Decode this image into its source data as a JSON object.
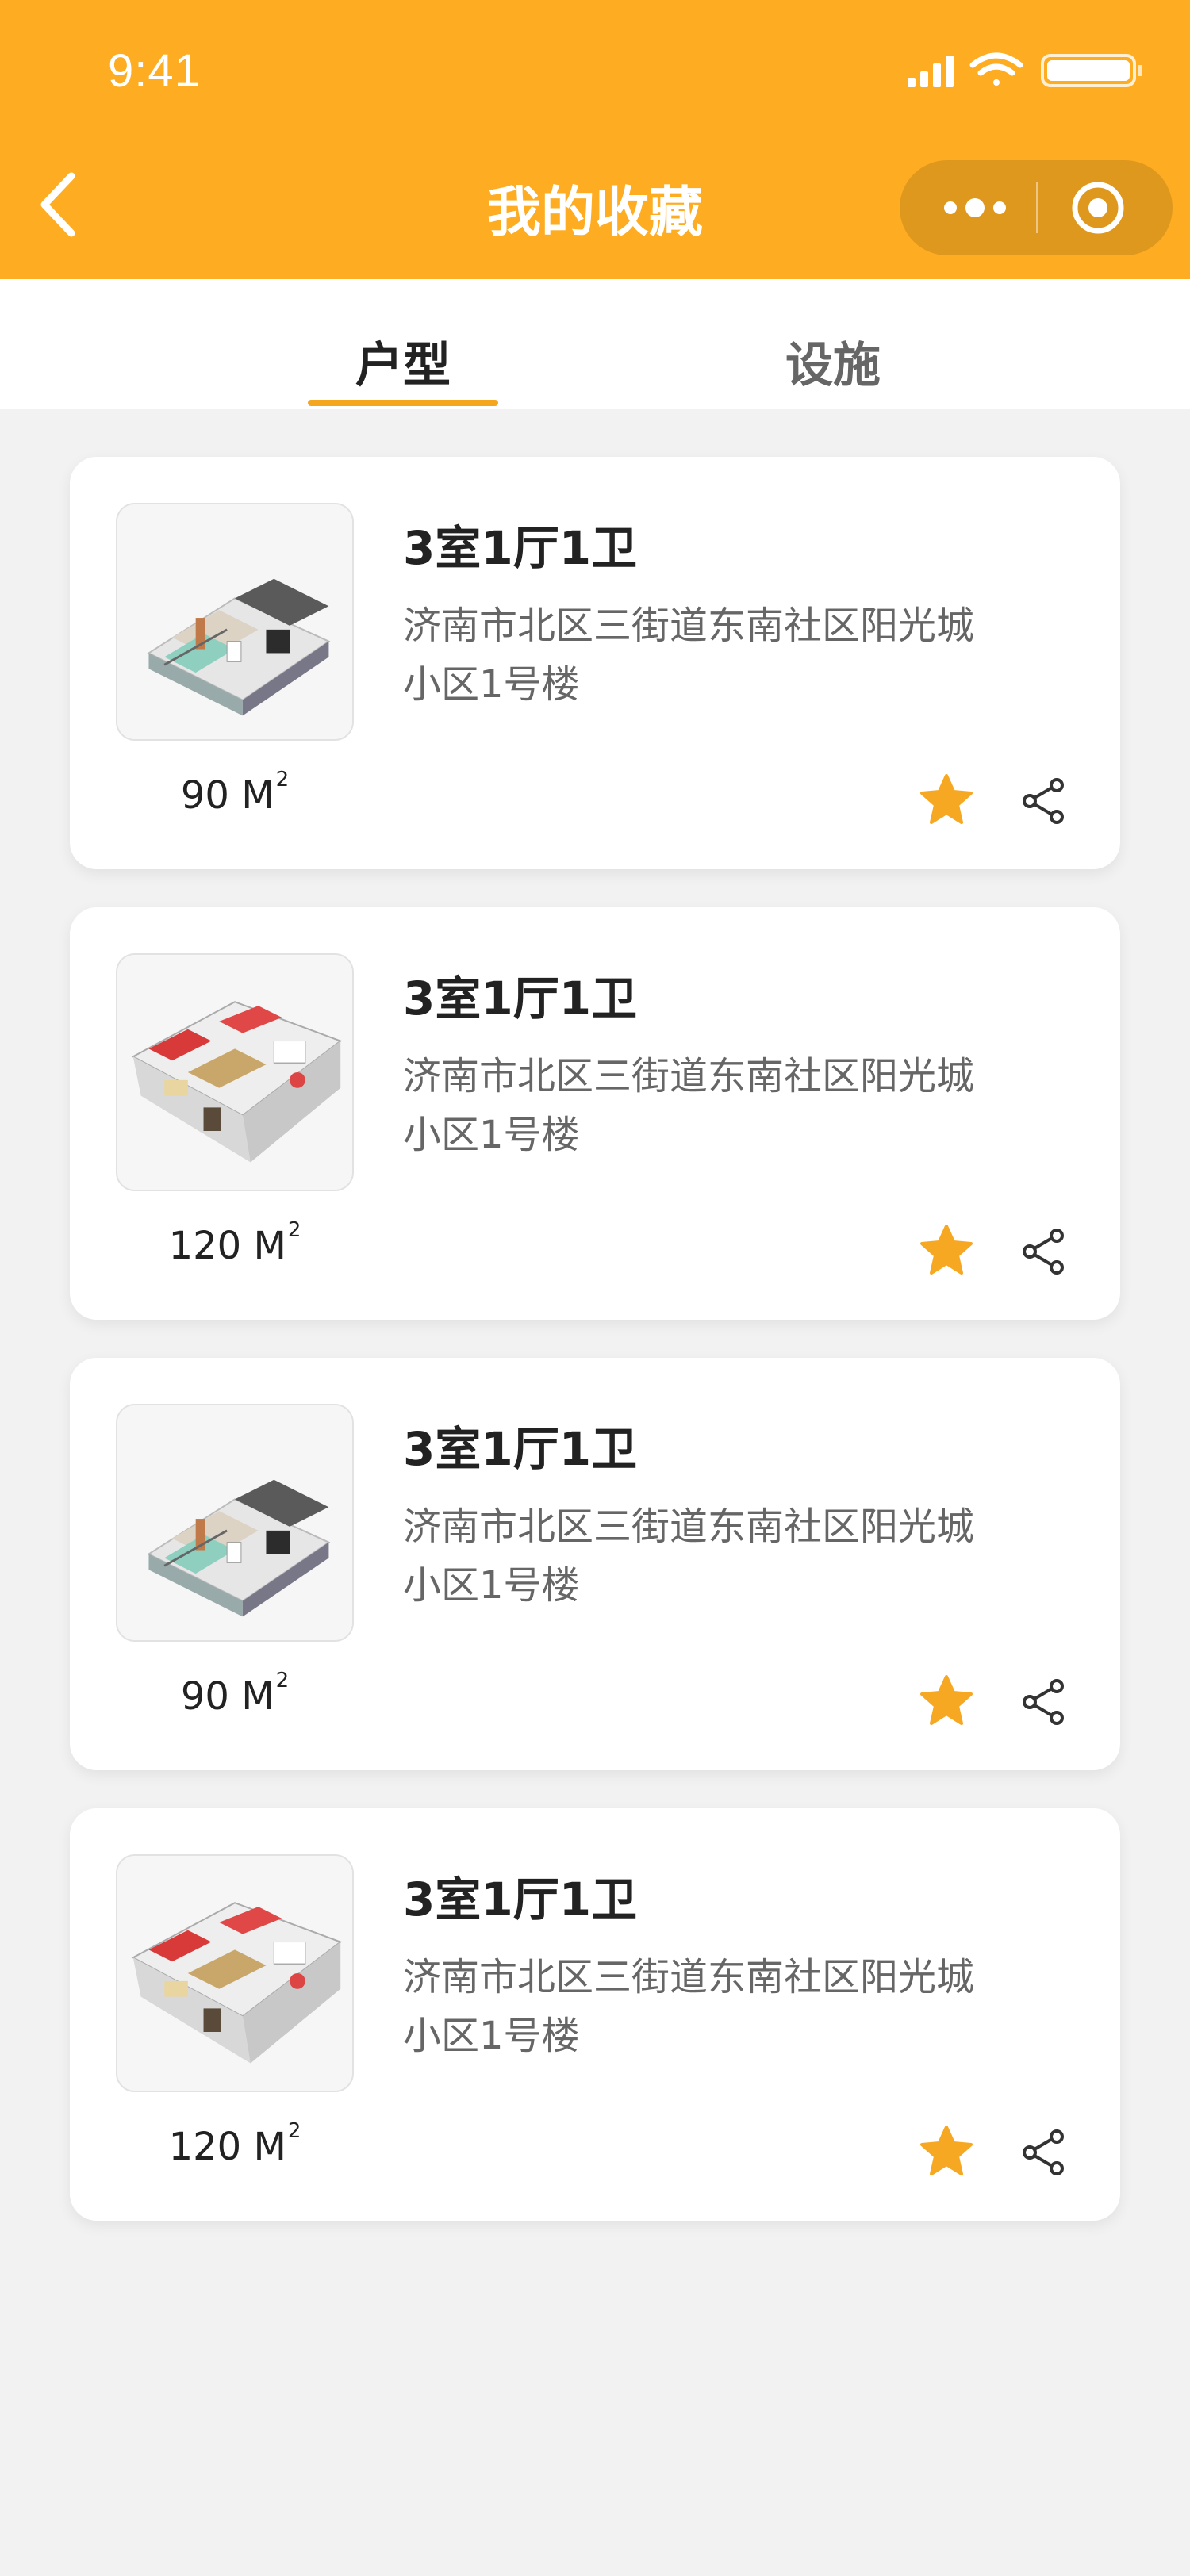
{
  "status_bar": {
    "time": "9:41"
  },
  "nav": {
    "title": "我的收藏"
  },
  "tabs": [
    {
      "label": "户型",
      "active": true
    },
    {
      "label": "设施",
      "active": false
    }
  ],
  "colors": {
    "accent": "#fead23",
    "star": "#f7a823",
    "background": "#f2f2f2"
  },
  "cards": [
    {
      "title": "3室1厅1卫",
      "address": "济南市北区三街道东南社区阳光城小区1号楼",
      "area": "90",
      "unit": "M",
      "unit_sup": "2",
      "favorited": true
    },
    {
      "title": "3室1厅1卫",
      "address": "济南市北区三街道东南社区阳光城小区1号楼",
      "area": "120",
      "unit": "M",
      "unit_sup": "2",
      "favorited": true
    },
    {
      "title": "3室1厅1卫",
      "address": "济南市北区三街道东南社区阳光城小区1号楼",
      "area": "90",
      "unit": "M",
      "unit_sup": "2",
      "favorited": true
    },
    {
      "title": "3室1厅1卫",
      "address": "济南市北区三街道东南社区阳光城小区1号楼",
      "area": "120",
      "unit": "M",
      "unit_sup": "2",
      "favorited": true
    }
  ]
}
